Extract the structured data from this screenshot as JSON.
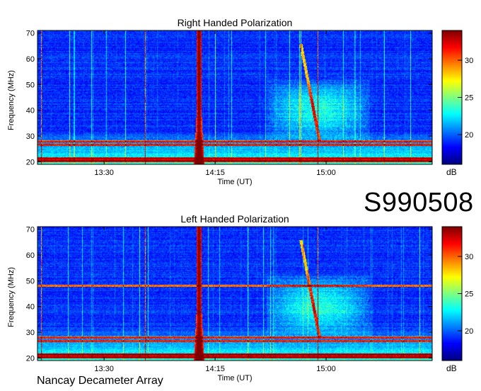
{
  "station_id": "S990508",
  "footer": "Nancay Decameter Array",
  "chart_data": [
    {
      "type": "heatmap",
      "title": "Right Handed Polarization",
      "xlabel": "Time (UT)",
      "ylabel": "Frequency (MHz)",
      "colorbar_label": "dB",
      "x_ticks": [
        "13:30",
        "14:15",
        "15:00"
      ],
      "x_tick_values_min": [
        810,
        855,
        900
      ],
      "xlim_min": [
        783,
        943
      ],
      "y_ticks": [
        20,
        30,
        40,
        50,
        60,
        70
      ],
      "ylim": [
        19,
        71
      ],
      "colorbar_ticks": [
        20,
        25,
        30
      ],
      "colorbar_range": [
        16,
        34
      ],
      "colormap": "jet",
      "features": {
        "background_db": 19,
        "broadband_burst_time_min": 848.5,
        "drifting_burst_time_min": 893,
        "emission_patch": {
          "time_min": [
            876,
            918
          ],
          "freq_mhz": [
            28,
            52
          ]
        },
        "rfi_bands_mhz": [
          20.2,
          21.2,
          26.5,
          27.8
        ]
      }
    },
    {
      "type": "heatmap",
      "title": "Left Handed Polarization",
      "xlabel": "Time (UT)",
      "ylabel": "Frequency (MHz)",
      "colorbar_label": "dB",
      "x_ticks": [
        "13:30",
        "14:15",
        "15:00"
      ],
      "x_tick_values_min": [
        810,
        855,
        900
      ],
      "xlim_min": [
        783,
        943
      ],
      "y_ticks": [
        20,
        30,
        40,
        50,
        60,
        70
      ],
      "ylim": [
        19,
        71
      ],
      "colorbar_ticks": [
        20,
        25,
        30
      ],
      "colorbar_range": [
        16,
        34
      ],
      "colormap": "jet",
      "features": {
        "background_db": 19,
        "broadband_burst_time_min": 848.5,
        "drifting_burst_time_min": 893,
        "emission_patch": {
          "time_min": [
            876,
            918
          ],
          "freq_mhz": [
            28,
            52
          ]
        },
        "rfi_bands_mhz": [
          20.2,
          21.2,
          26.5,
          27.8,
          48
        ]
      }
    }
  ]
}
